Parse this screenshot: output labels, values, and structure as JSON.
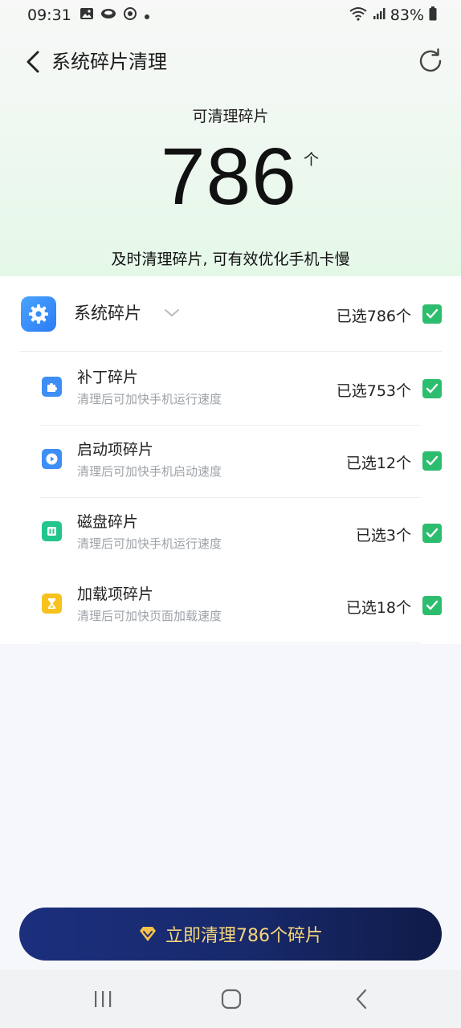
{
  "status_bar": {
    "time": "09:31",
    "battery": "83%",
    "left_icons": [
      "gallery-icon",
      "cloud-icon",
      "vpn-icon",
      "dot-icon"
    ],
    "right_icons": [
      "wifi-icon",
      "signal-icon",
      "battery-icon"
    ]
  },
  "header": {
    "title": "系统碎片清理"
  },
  "summary": {
    "label": "可清理碎片",
    "count": "786",
    "unit": "个",
    "hint": "及时清理碎片, 可有效优化手机卡慢"
  },
  "group": {
    "title": "系统碎片",
    "selected": "已选786个",
    "checked": true
  },
  "items": [
    {
      "title": "补丁碎片",
      "subtitle": "清理后可加快手机运行速度",
      "selected": "已选753个",
      "checked": true,
      "icon": "puzzle-icon",
      "color": "#3d8ef5"
    },
    {
      "title": "启动项碎片",
      "subtitle": "清理后可加快手机启动速度",
      "selected": "已选12个",
      "checked": true,
      "icon": "play-icon",
      "color": "#3d8ef5"
    },
    {
      "title": "磁盘碎片",
      "subtitle": "清理后可加快手机运行速度",
      "selected": "已选3个",
      "checked": true,
      "icon": "disk-icon",
      "color": "#22c58b"
    },
    {
      "title": "加载项碎片",
      "subtitle": "清理后可加快页面加载速度",
      "selected": "已选18个",
      "checked": true,
      "icon": "hourglass-icon",
      "color": "#f7c21d"
    }
  ],
  "action": {
    "label": "立即清理786个碎片"
  },
  "colors": {
    "accent_green": "#2dbd6e",
    "button_dark": "#1b2f7d",
    "button_text": "#f7d77a"
  }
}
